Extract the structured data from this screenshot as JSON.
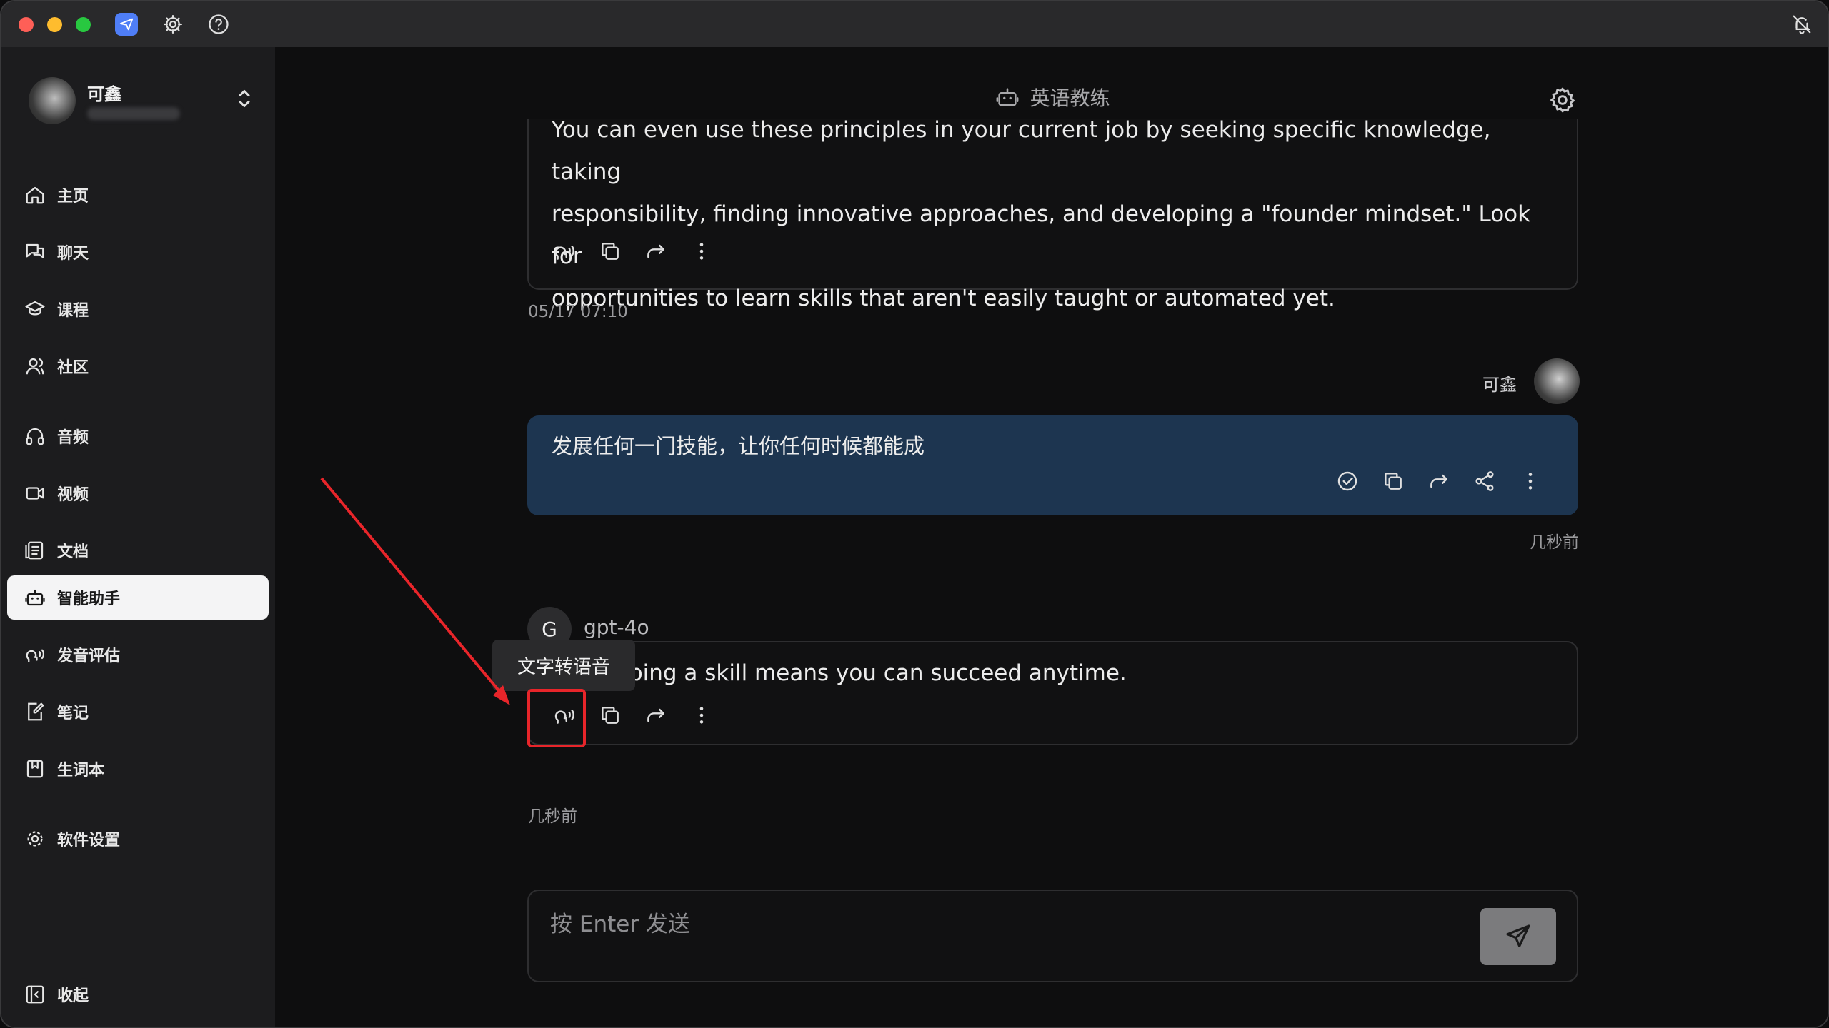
{
  "window": {
    "title": "英语教练"
  },
  "titlebar": {
    "icons": [
      "app-icon",
      "gear-icon",
      "help-icon",
      "notification-off-icon"
    ]
  },
  "sidebar": {
    "profile": {
      "name": "可鑫"
    },
    "items": [
      {
        "label": "主页",
        "icon": "home-icon"
      },
      {
        "label": "聊天",
        "icon": "chat-icon"
      },
      {
        "label": "课程",
        "icon": "graduation-cap-icon"
      },
      {
        "label": "社区",
        "icon": "users-icon"
      },
      {
        "label": "音频",
        "icon": "headphones-icon"
      },
      {
        "label": "视频",
        "icon": "video-icon"
      },
      {
        "label": "文档",
        "icon": "document-icon"
      },
      {
        "label": "智能助手",
        "icon": "bot-icon",
        "active": true
      },
      {
        "label": "发音评估",
        "icon": "speech-icon"
      },
      {
        "label": "笔记",
        "icon": "note-icon"
      },
      {
        "label": "生词本",
        "icon": "bookmark-icon"
      },
      {
        "label": "软件设置",
        "icon": "gear-icon"
      }
    ],
    "collapse_label": "收起"
  },
  "chat": {
    "header_title": "英语教练",
    "messages": [
      {
        "role": "assistant",
        "lines": [
          "You can even use these principles in your current job by seeking specific knowledge, taking",
          "responsibility, finding innovative approaches, and developing a \"founder mindset.\" Look for",
          "opportunities to learn skills that aren't easily taught or automated yet."
        ],
        "timestamp": "05/17 07:10"
      },
      {
        "role": "user",
        "name": "可鑫",
        "text": "发展任何一门技能，让你任何时候都能成",
        "timestamp": "几秒前"
      },
      {
        "role": "assistant",
        "model": "gpt-4o",
        "avatar_letter": "G",
        "text": "Developing a skill means you can succeed anytime.",
        "timestamp": "几秒前"
      }
    ],
    "tooltip": "文字转语音",
    "input_placeholder": "按 Enter 发送"
  },
  "colors": {
    "accent_user_bubble": "#1d3550",
    "highlight": "#e8252a",
    "sidebar_active": "#f4f4f5"
  }
}
